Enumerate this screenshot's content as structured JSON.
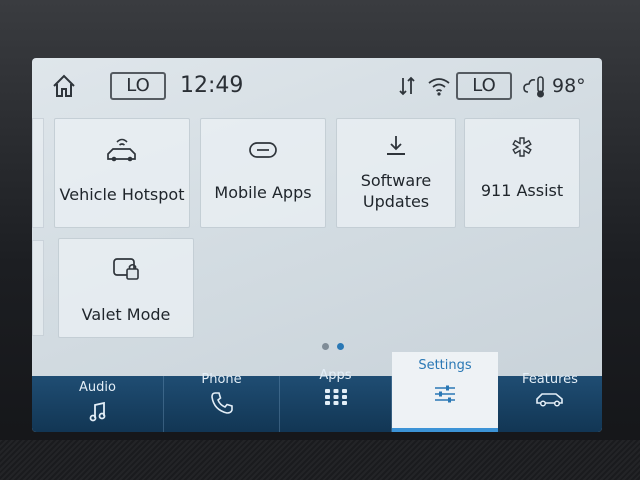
{
  "status_bar": {
    "home_icon": "home-icon",
    "fan_level_left": "LO",
    "time": "12:49",
    "fan_level_right": "LO",
    "temperature": "98°",
    "icons": [
      "data-transfer-icon",
      "wifi-icon",
      "weather-icon"
    ]
  },
  "tiles": [
    {
      "label": "Vehicle Hotspot",
      "icon": "vehicle-hotspot-icon"
    },
    {
      "label": "Mobile Apps",
      "icon": "mobile-apps-icon"
    },
    {
      "label_line1": "Software",
      "label_line2": "Updates",
      "icon": "download-icon"
    },
    {
      "label": "911 Assist",
      "icon": "medical-star-icon"
    },
    {
      "label": "Valet Mode",
      "icon": "valet-lock-icon"
    }
  ],
  "pagination": {
    "pages": 2,
    "current": 2,
    "active_color": "#2a78b5",
    "inactive_color": "#7f8c97"
  },
  "nav": {
    "items": [
      {
        "label": "Audio",
        "icon": "music-note-icon"
      },
      {
        "label": "Phone",
        "icon": "phone-icon"
      },
      {
        "label": "Apps",
        "icon": "apps-grid-icon"
      },
      {
        "label": "Settings",
        "icon": "settings-sliders-icon",
        "active": true
      },
      {
        "label": "Features",
        "icon": "car-icon"
      }
    ],
    "bar_color": "#123654",
    "active_color": "#2a78b5"
  }
}
